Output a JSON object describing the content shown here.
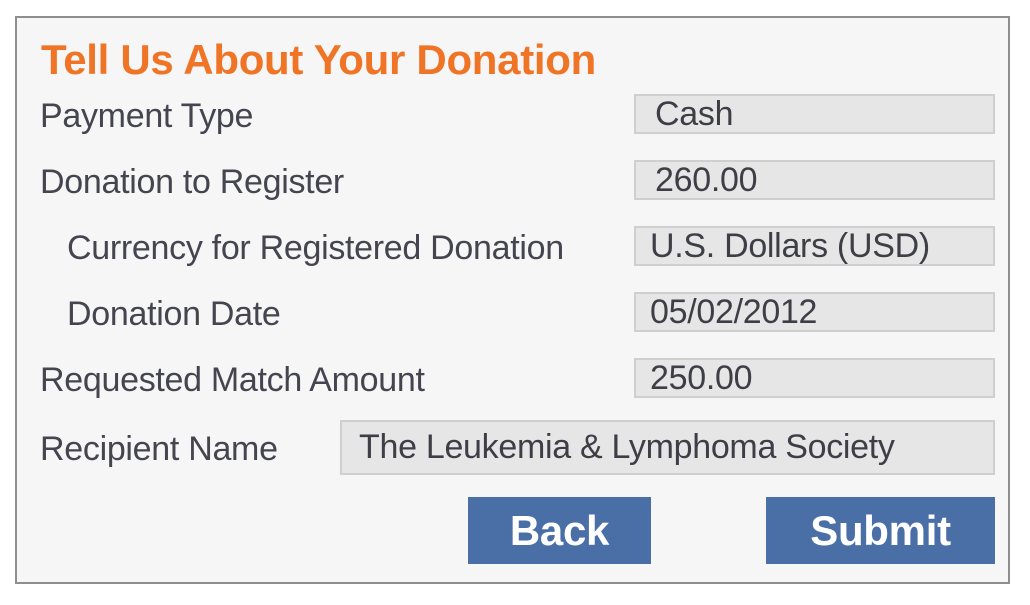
{
  "form": {
    "title": "Tell Us About Your Donation",
    "fields": [
      {
        "label": "Payment Type",
        "value": "Cash"
      },
      {
        "label": "Donation to Register",
        "value": "260.00"
      },
      {
        "label": "Currency for Registered Donation",
        "value": "U.S. Dollars (USD)"
      },
      {
        "label": "Donation Date",
        "value": "05/02/2012"
      },
      {
        "label": "Requested Match Amount",
        "value": "250.00"
      },
      {
        "label": "Recipient Name",
        "value": "The Leukemia & Lymphoma Society"
      }
    ],
    "buttons": {
      "back": "Back",
      "submit": "Submit"
    }
  },
  "colors": {
    "title": "#ef7425",
    "button": "#4a6fa6",
    "field_bg": "#e6e6e6",
    "panel_bg": "#f6f6f6"
  }
}
